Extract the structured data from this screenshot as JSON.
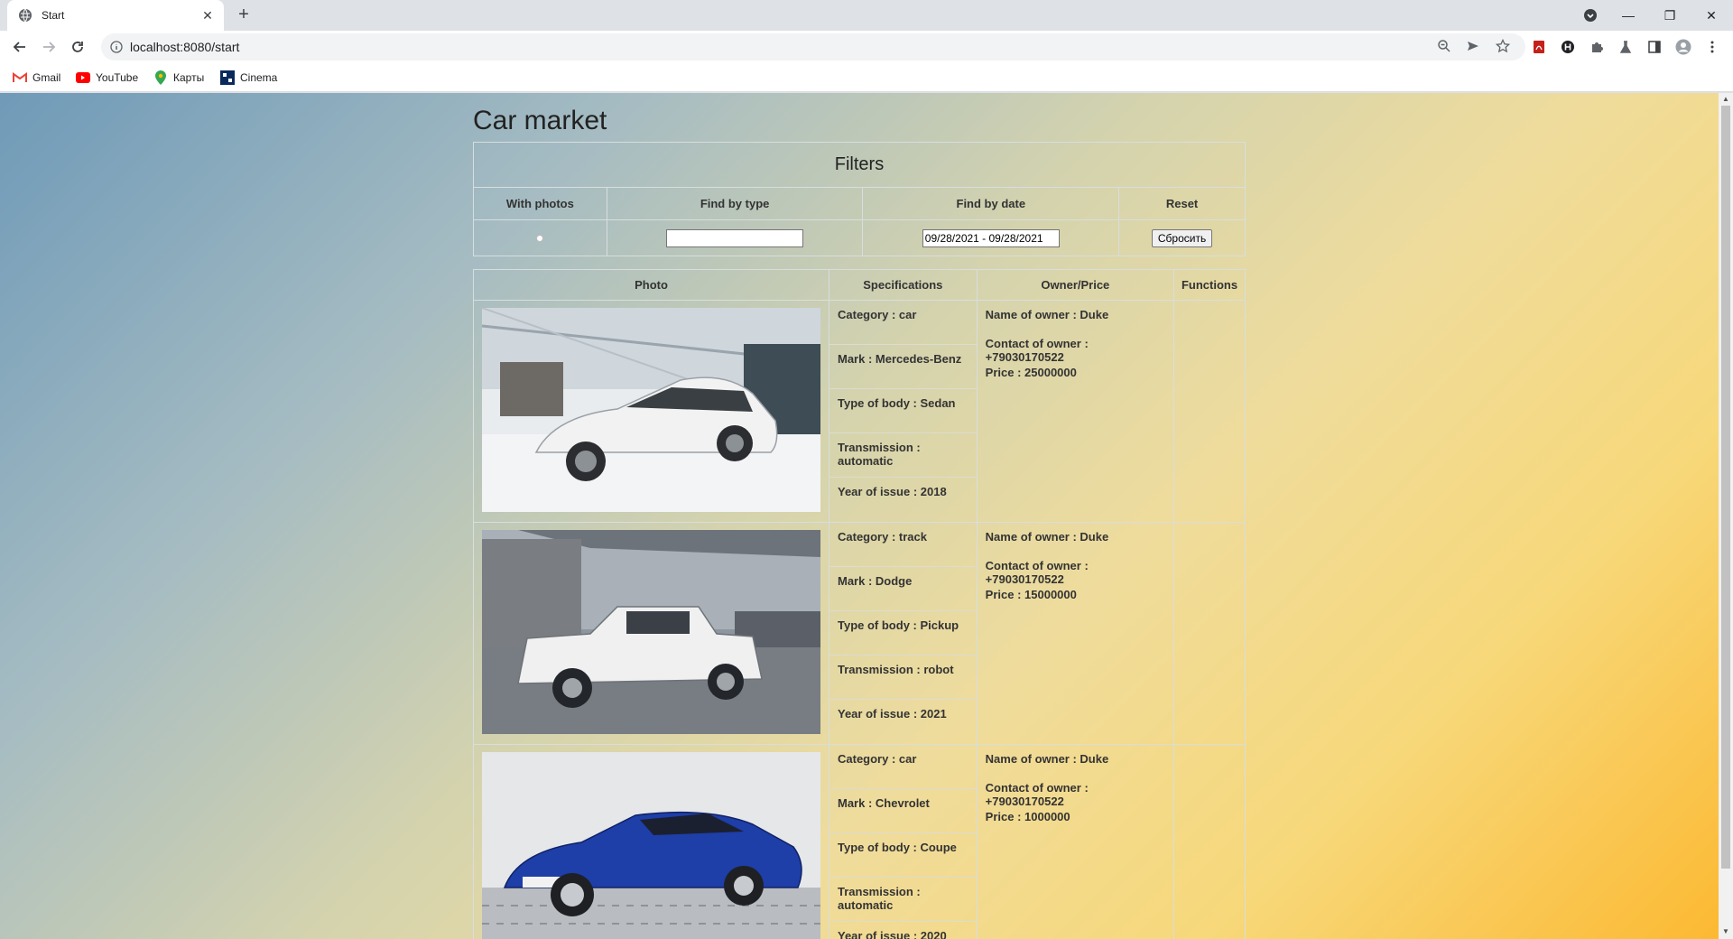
{
  "browser": {
    "tab_title": "Start",
    "url": "localhost:8080/start",
    "bookmarks": [
      {
        "label": "Gmail"
      },
      {
        "label": "YouTube"
      },
      {
        "label": "Карты"
      },
      {
        "label": "Cinema"
      }
    ]
  },
  "page": {
    "title": "Car market",
    "filters": {
      "title": "Filters",
      "headers": [
        "With photos",
        "Find by type",
        "Find by date",
        "Reset"
      ],
      "type_value": "",
      "date_value": "09/28/2021 - 09/28/2021",
      "reset_label": "Сбросить"
    },
    "table": {
      "headers": [
        "Photo",
        "Specifications",
        "Owner/Price",
        "Functions"
      ],
      "rows": [
        {
          "category": "Category : car",
          "mark": "Mark : Mercedes-Benz",
          "body": "Type of body : Sedan",
          "transmission": "Transmission : automatic",
          "year": "Year of issue : 2018",
          "owner": "Name of owner : Duke",
          "contact": "Contact of owner : +79030170522",
          "price": "Price : 25000000",
          "car_color": "#f2f2f2"
        },
        {
          "category": "Category : track",
          "mark": "Mark : Dodge",
          "body": "Type of body : Pickup",
          "transmission": "Transmission : robot",
          "year": "Year of issue : 2021",
          "owner": "Name of owner : Duke",
          "contact": "Contact of owner : +79030170522",
          "price": "Price : 15000000",
          "car_color": "#f0f0f0"
        },
        {
          "category": "Category : car",
          "mark": "Mark : Chevrolet",
          "body": "Type of body : Coupe",
          "transmission": "Transmission : automatic",
          "year": "Year of issue : 2020",
          "owner": "Name of owner : Duke",
          "contact": "Contact of owner : +79030170522",
          "price": "Price : 1000000",
          "car_color": "#1e3ea8"
        }
      ]
    }
  }
}
